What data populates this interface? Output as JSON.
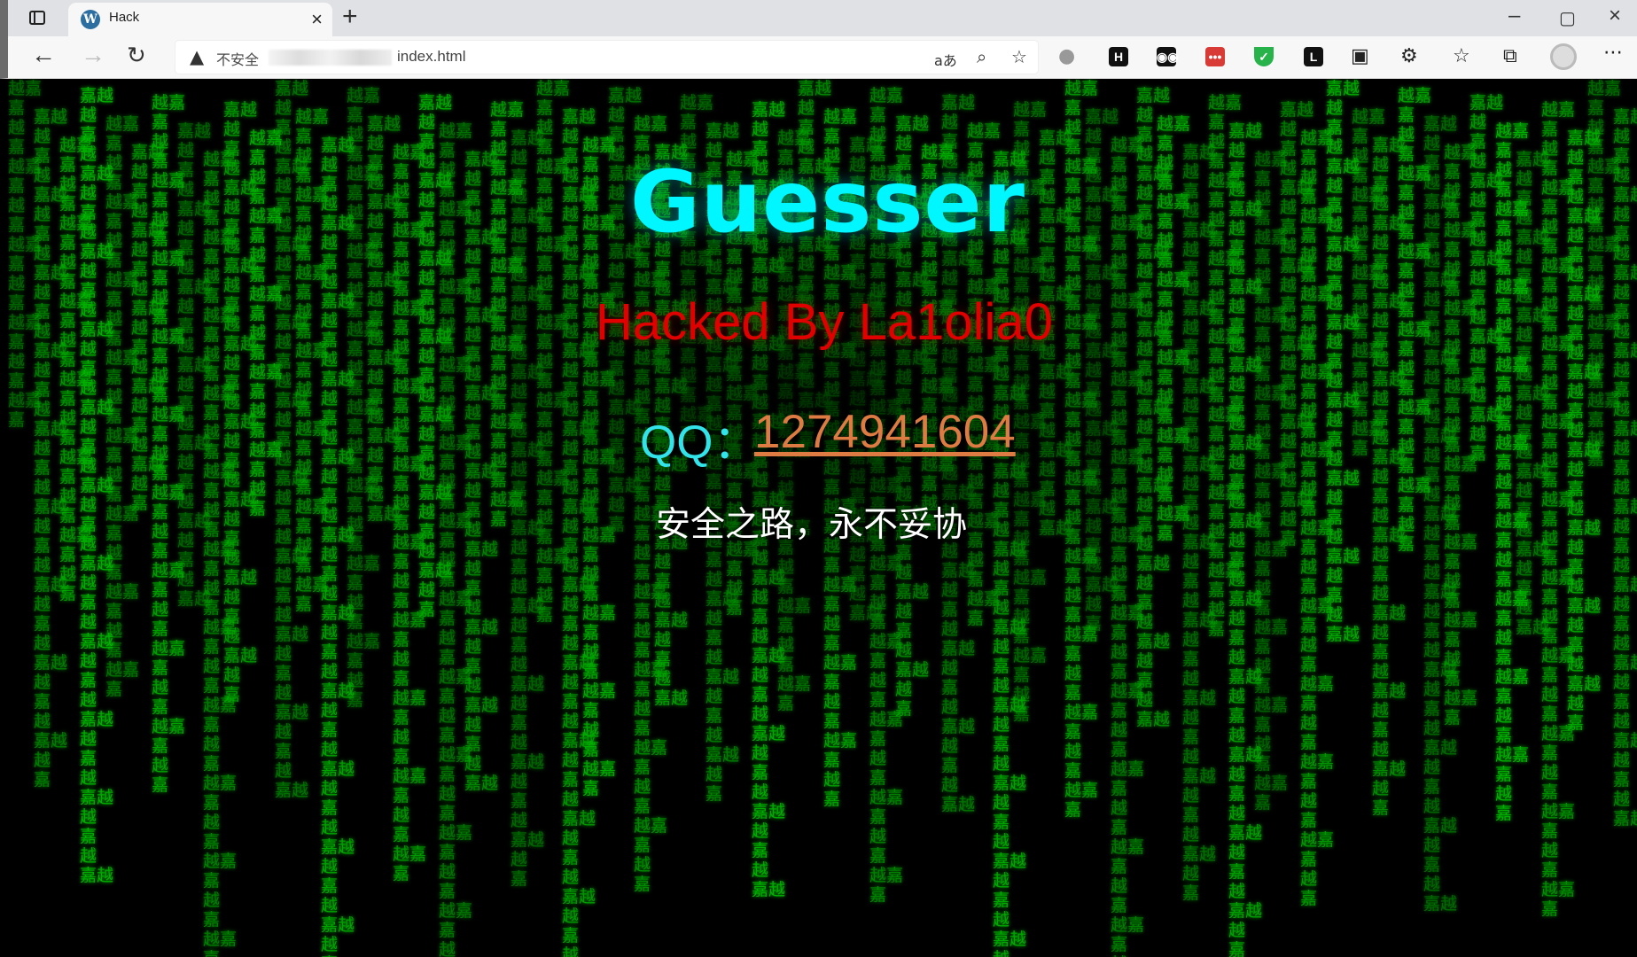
{
  "browser": {
    "tab_title": "Hack",
    "tab_favicon": "W",
    "security_warning": "不安全",
    "url": "index.html",
    "extension_labels": [
      "H",
      "L"
    ],
    "window_controls": [
      "–",
      "▢",
      "×"
    ]
  },
  "page": {
    "title": "Guesser",
    "hacked_by": "Hacked By La1olia0",
    "qq_label": "QQ：",
    "qq_number": "1274941604",
    "motto": "安全之路，永不妥协",
    "matrix_chars": [
      "越",
      "嘉"
    ]
  },
  "colors": {
    "title": "#00f7ff",
    "hacked": "#e00000",
    "qq_label": "#33e3ea",
    "qq_number": "#dd7b43",
    "matrix": "#00d800"
  }
}
